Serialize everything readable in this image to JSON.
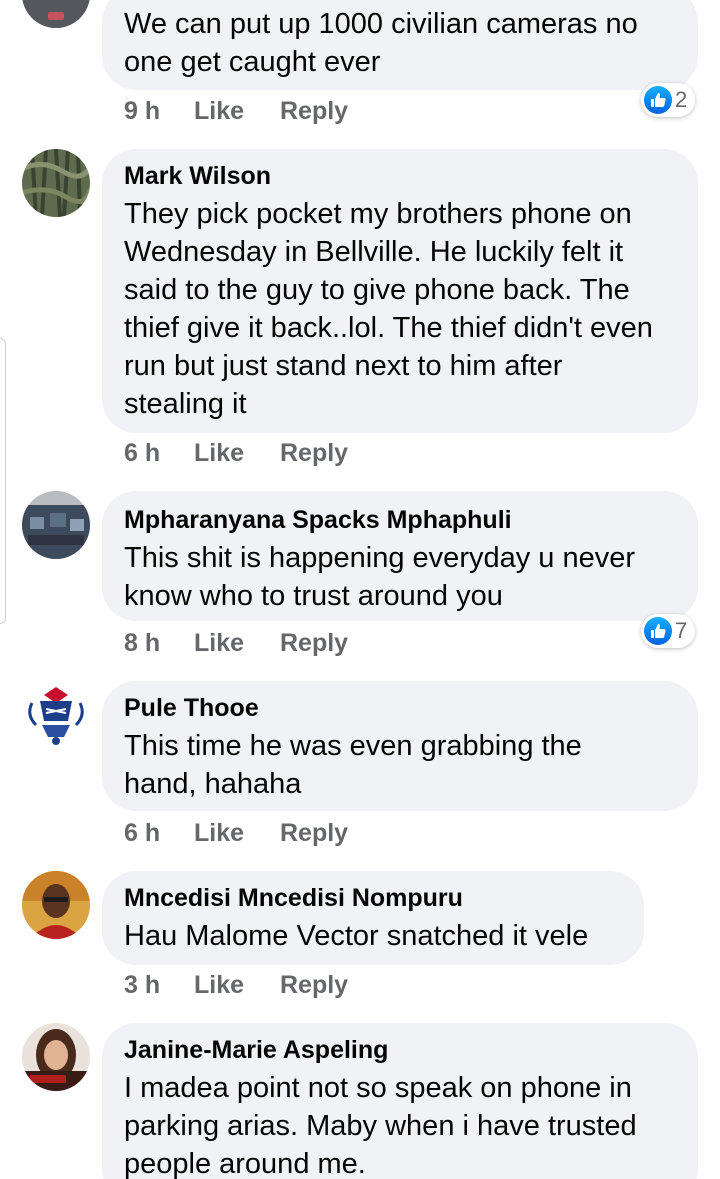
{
  "comments": [
    {
      "author": "",
      "lines": [
        "We can put up 1000 civilian cameras no",
        "one get caught ever"
      ],
      "time": "9 h",
      "like_label": "Like",
      "reply_label": "Reply",
      "reactions": "2",
      "avatar_icon": "profile-avatar"
    },
    {
      "author": "Mark Wilson",
      "lines": [
        "They pick pocket my brothers phone on",
        "Wednesday in Bellville. He luckily felt it",
        "said to the guy to give phone back. The",
        "thief give it back..lol. The thief didn't even",
        "run but just stand next to him after",
        "stealing it"
      ],
      "time": "6 h",
      "like_label": "Like",
      "reply_label": "Reply",
      "avatar_icon": "profile-avatar"
    },
    {
      "author": "Mpharanyana Spacks Mphaphuli",
      "lines": [
        "This shit is happening everyday u never",
        "know who to trust around you"
      ],
      "time": "8 h",
      "like_label": "Like",
      "reply_label": "Reply",
      "reactions": "7",
      "avatar_icon": "profile-avatar"
    },
    {
      "author": "Pule Thooe",
      "lines": [
        "This time he was even grabbing the",
        "hand, hahaha"
      ],
      "time": "6 h",
      "like_label": "Like",
      "reply_label": "Reply",
      "avatar_icon": "emblem-avatar"
    },
    {
      "author": "Mncedisi Mncedisi Nompuru",
      "lines": [
        "Hau Malome Vector snatched it vele"
      ],
      "time": "3 h",
      "like_label": "Like",
      "reply_label": "Reply",
      "avatar_icon": "profile-avatar"
    },
    {
      "author": "Janine-Marie Aspeling",
      "lines": [
        "I madea point not so speak on phone in",
        "parking arias. Maby when i have trusted",
        "people around me."
      ],
      "avatar_icon": "profile-avatar"
    }
  ],
  "colors": {
    "bubble": "#f0f2f5",
    "meta_text": "#65676b",
    "like_blue": "#1877f2"
  }
}
